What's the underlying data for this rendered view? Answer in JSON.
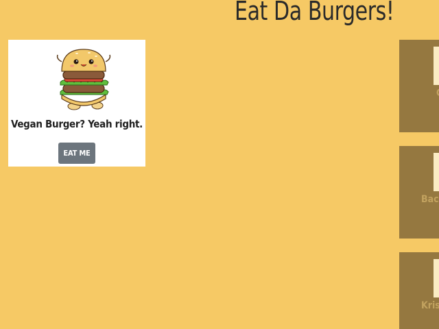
{
  "header": {
    "title": "Eat Da Burgers!"
  },
  "menu_card": {
    "caption": "Vegan Burger? Yeah right.",
    "button_label": "EAT ME",
    "image_icon": "cute-burger-icon"
  },
  "eaten_burgers": [
    {
      "label": "C"
    },
    {
      "label": "Bacc"
    },
    {
      "label": "Kris"
    }
  ],
  "colors": {
    "background": "#f6c965",
    "eaten_card": "#957840",
    "button": "#6c757d"
  }
}
